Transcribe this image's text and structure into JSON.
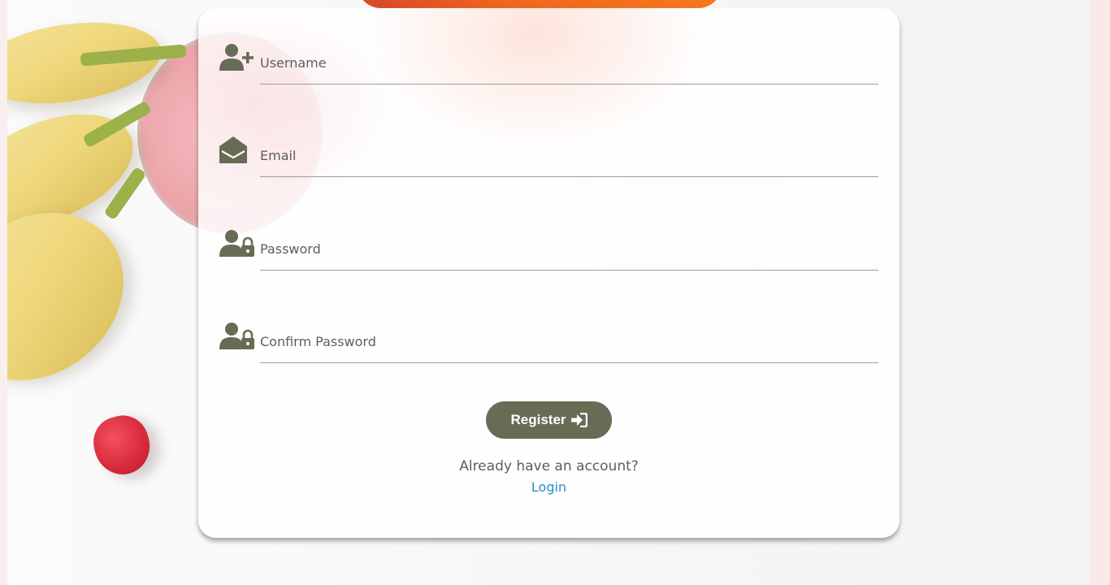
{
  "form": {
    "username": {
      "placeholder": "Username",
      "value": "",
      "icon": "user-plus-icon"
    },
    "email": {
      "placeholder": "Email",
      "value": "",
      "icon": "envelope-open-icon"
    },
    "password": {
      "placeholder": "Password",
      "value": "",
      "icon": "user-lock-icon"
    },
    "confirm_password": {
      "placeholder": "Confirm Password",
      "value": "",
      "icon": "user-lock-icon"
    },
    "register_label": "Register",
    "register_icon": "sign-in-icon"
  },
  "footer": {
    "prompt": "Already have an account?",
    "login_label": "Login"
  },
  "colors": {
    "accent": "#676c55",
    "link": "#2792c7",
    "icon": "#676c55"
  }
}
